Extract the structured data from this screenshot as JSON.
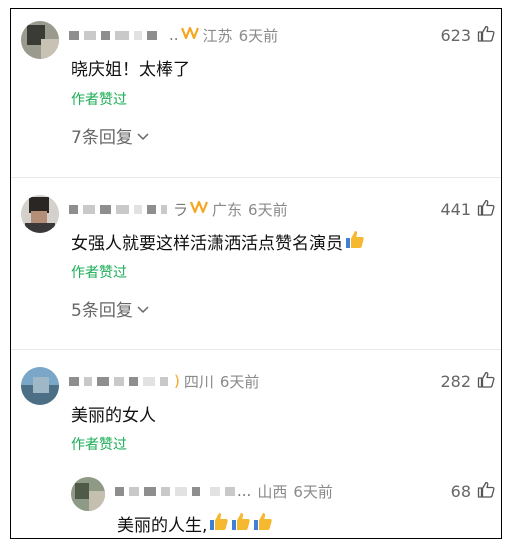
{
  "comments": [
    {
      "location": "江苏",
      "time": "6天前",
      "likes": "623",
      "text": "晓庆姐！太棒了",
      "author_liked": "作者赞过",
      "replies": "7条回复"
    },
    {
      "location": "广东",
      "time": "6天前",
      "likes": "441",
      "text": "女强人就要这样活潇洒活点赞名演员",
      "author_liked": "作者赞过",
      "replies": "5条回复"
    },
    {
      "location": "四川",
      "time": "6天前",
      "likes": "282",
      "text": "美丽的女人",
      "author_liked": "作者赞过"
    },
    {
      "location": "山西",
      "time": "6天前",
      "likes": "68",
      "text": "美丽的人生,",
      "ellipsis": "..."
    }
  ],
  "icons": {
    "like": "thumbs-up-outline-icon",
    "chevron": "chevron-down-icon",
    "emoji": "thumbs-up-emoji",
    "weibo": "weibo-v-icon"
  },
  "colors": {
    "accent_green": "#1aad56",
    "meta_gray": "#8a8a8a",
    "weibo_orange": "#f5a623"
  }
}
